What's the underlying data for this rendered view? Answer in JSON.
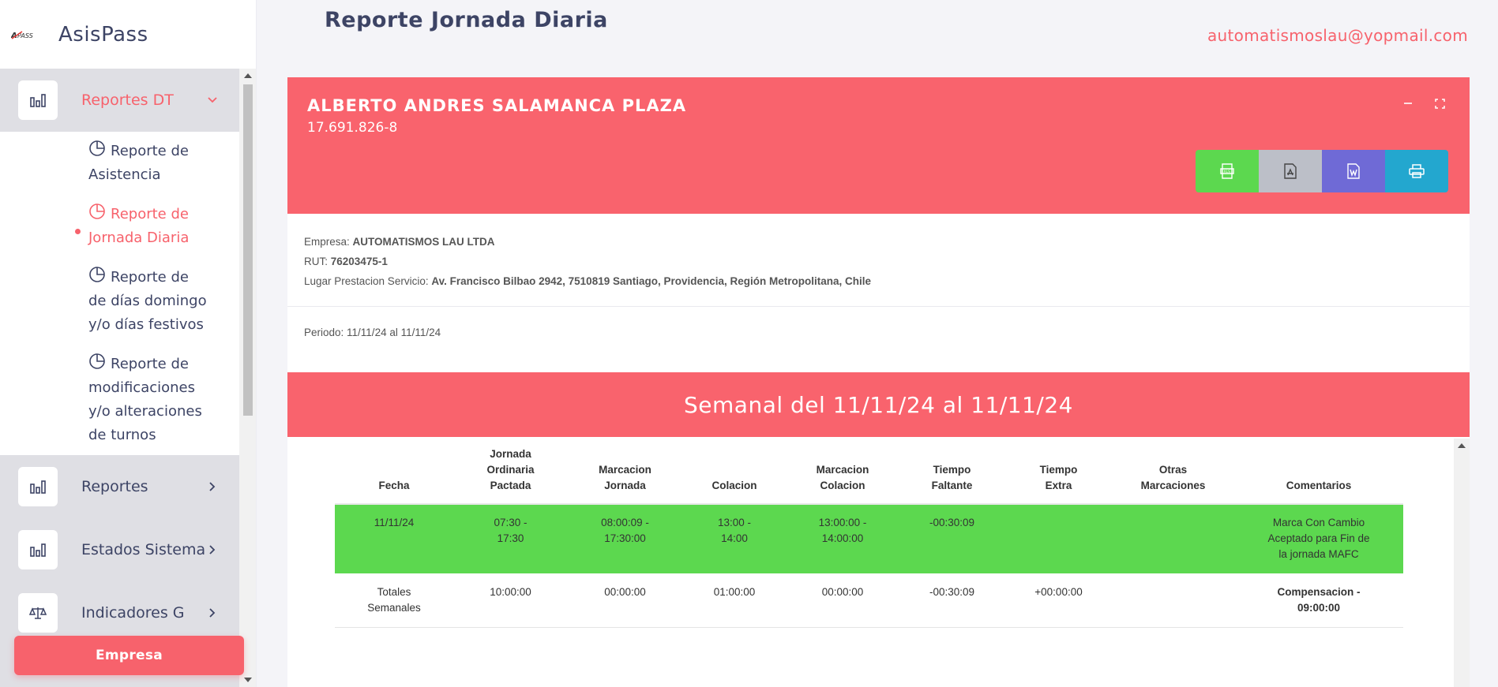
{
  "app": {
    "name": "AsisPass",
    "logo_text": "AsisPass"
  },
  "header": {
    "title": "Reporte Jornada Diaria",
    "user_email": "automatismoslau@yopmail.com"
  },
  "sidebar": {
    "menu": [
      {
        "label": "Reportes DT",
        "icon": "bar-chart-icon",
        "active": true
      },
      {
        "label": "Reportes",
        "icon": "bar-chart-icon"
      },
      {
        "label": "Estados Sistema",
        "icon": "bar-chart-icon"
      },
      {
        "label": "Indicadores G",
        "icon": "scale-icon"
      }
    ],
    "submenu": [
      {
        "label": "Reporte de\nAsistencia"
      },
      {
        "label": "Reporte de\nJornada Diaria",
        "current": true
      },
      {
        "label": "Reporte de\nde días domingo\ny/o días festivos"
      },
      {
        "label": "Reporte de\nmodificaciones\ny/o alteraciones\nde turnos"
      }
    ],
    "empresa_button": "Empresa"
  },
  "employee": {
    "name": "ALBERTO ANDRES SALAMANCA PLAZA",
    "rut": "17.691.826-8"
  },
  "export_buttons": [
    {
      "name": "xls",
      "icon": "excel-icon",
      "color": "#5cd84f"
    },
    {
      "name": "pdf",
      "icon": "pdf-icon",
      "color": "#bcbfc8"
    },
    {
      "name": "word",
      "icon": "word-icon",
      "color": "#6f6ad6"
    },
    {
      "name": "print",
      "icon": "print-icon",
      "color": "#23a7cf"
    }
  ],
  "company": {
    "empresa_label": "Empresa:",
    "empresa_value": "AUTOMATISMOS LAU LTDA",
    "rut_label": "RUT:",
    "rut_value": "76203475-1",
    "lugar_label": "Lugar Prestacion Servicio:",
    "lugar_value": "Av. Francisco Bilbao 2942, 7510819 Santiago, Providencia, Región Metropolitana, Chile"
  },
  "periodo": "Periodo: 11/11/24 al 11/11/24",
  "week_banner": "Semanal del 11/11/24 al 11/11/24",
  "table": {
    "headers": [
      "Fecha",
      "Jornada\nOrdinaria\nPactada",
      "Marcacion\nJornada",
      "Colacion",
      "Marcacion\nColacion",
      "Tiempo\nFaltante",
      "Tiempo\nExtra",
      "Otras\nMarcaciones",
      "Comentarios"
    ],
    "row": [
      "11/11/24",
      "07:30 -\n17:30",
      "08:00:09 -\n17:30:00",
      "13:00 -\n14:00",
      "13:00:00 -\n14:00:00",
      "-00:30:09",
      "",
      "",
      "Marca Con Cambio\nAceptado para Fin de\nla jornada MAFC"
    ],
    "totals": [
      "Totales\nSemanales",
      "10:00:00",
      "00:00:00",
      "01:00:00",
      "00:00:00",
      "-00:30:09",
      "+00:00:00",
      "",
      "Compensacion -\n09:00:00"
    ]
  },
  "colors": {
    "accent": "#f7626c",
    "row_ok": "#5cd84f",
    "text": "#3d4465"
  }
}
